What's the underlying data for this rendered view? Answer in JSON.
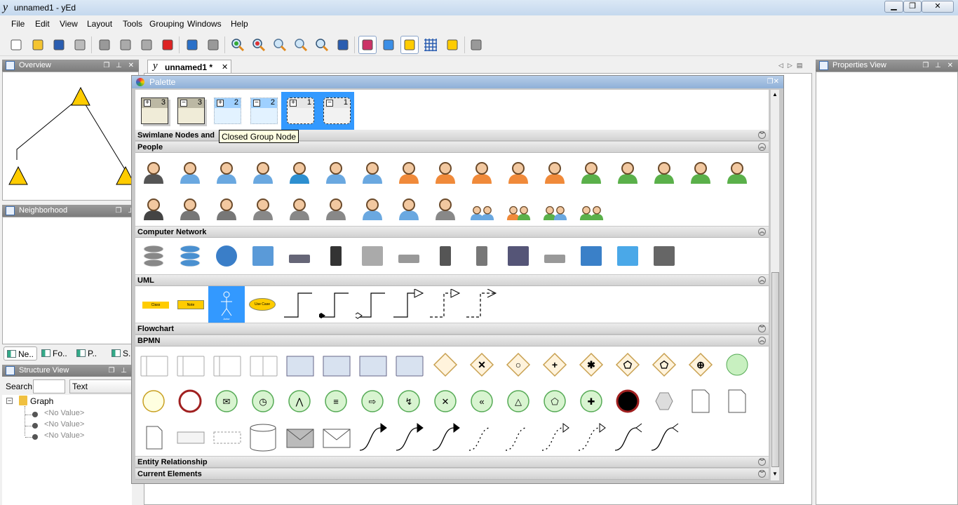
{
  "window": {
    "title": "unnamed1 - yEd",
    "min": "▁",
    "max": "❐",
    "close": "✕"
  },
  "menu": [
    "File",
    "Edit",
    "View",
    "Layout",
    "Tools",
    "Grouping",
    "Windows",
    "Help"
  ],
  "toolbar": [
    "new-document",
    "open-folder",
    "save",
    "print",
    "cut",
    "copy",
    "paste",
    "delete",
    "undo",
    "redo",
    "zoom-in",
    "zoom-out",
    "zoom-1to1",
    "zoom-fit",
    "zoom-area",
    "fit-content",
    "edit-mode",
    "move-mode",
    "snap-lines",
    "grid",
    "orthogonal-edges",
    "plugin"
  ],
  "panels": {
    "overview": {
      "title": "Overview",
      "controls": "❐ ⊥ ✕"
    },
    "neighborhood": {
      "title": "Neighborhood",
      "controls": "❐ ⊥"
    },
    "tabs": [
      "Ne..",
      "Fo..",
      "P..",
      "S.."
    ],
    "structure": {
      "title": "Structure View",
      "controls": "❐ ⊥",
      "search_label": "Search",
      "search_value": "",
      "filter": "Text",
      "tree": {
        "root": "Graph",
        "children": [
          "<No Value>",
          "<No Value>",
          "<No Value>"
        ]
      }
    },
    "properties": {
      "title": "Properties View",
      "controls": "❐ ⊥ ✕"
    }
  },
  "document_tab": {
    "label": "unnamed1 *",
    "close": "✕"
  },
  "palette": {
    "title": "Palette",
    "group_nodes": [
      {
        "sign": "+",
        "count": "3"
      },
      {
        "sign": "−",
        "count": "3"
      },
      {
        "sign": "+",
        "count": "2"
      },
      {
        "sign": "−",
        "count": "2"
      },
      {
        "sign": "+",
        "count": "1"
      },
      {
        "sign": "−",
        "count": "1"
      }
    ],
    "tooltip": "Closed Group Node",
    "sections": {
      "swimlane": "Swimlane Nodes and",
      "people": "People",
      "network": "Computer Network",
      "uml": "UML",
      "flowchart": "Flowchart",
      "bpmn": "BPMN",
      "er": "Entity Relationship",
      "current": "Current Elements"
    },
    "people_colors": [
      "#555",
      "#6aa8e0",
      "#6aa8e0",
      "#6aa8e0",
      "#2d8fd0",
      "#6aa8e0",
      "#6aa8e0",
      "#f08a3a",
      "#f08a3a",
      "#f08a3a",
      "#f08a3a",
      "#f08a3a",
      "#5ab04a",
      "#5ab04a",
      "#5ab04a",
      "#5ab04a",
      "#5ab04a",
      "#444",
      "#777",
      "#777",
      "#888",
      "#888",
      "#888",
      "#6aa8e0",
      "#6aa8e0",
      "#888",
      "#6aa8e0",
      "#f08a3a",
      "#5ab04a",
      "#5ab04a"
    ],
    "network": [
      "database",
      "database-blue",
      "globe",
      "network-tree",
      "laptop",
      "server-tower",
      "printer",
      "scanner",
      "server-rack",
      "mobile",
      "speaker",
      "switch",
      "monitor",
      "wireless",
      "workstation"
    ],
    "uml": {
      "class": "Class",
      "note": "Note",
      "actor": "Actor",
      "usecase": "Use Case"
    },
    "accent": "#3399ff"
  }
}
